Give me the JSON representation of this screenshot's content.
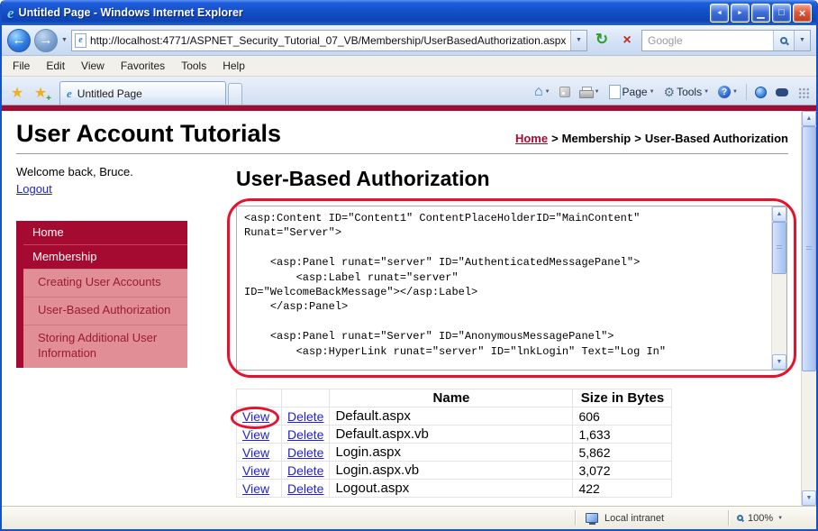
{
  "colors": {
    "accent_red": "#A50B31",
    "nav_secondary_bg": "#E18E96",
    "nav_secondary_text": "#9B1B33",
    "annotation_red": "#E8112D",
    "link_blue": "#2222CC"
  },
  "icons": {
    "ie_e": "e",
    "back_arrow": "←",
    "forward_arrow": "→",
    "dropdown": "▼",
    "refresh": "↻",
    "stop": "×",
    "minimize": "▁",
    "maximize": "□",
    "close": "×",
    "extra_left": "◄",
    "extra_right": "►",
    "favorites_star": "★",
    "add_star": "★",
    "home": "⌂",
    "gear": "⚙",
    "help": "?"
  },
  "window": {
    "title": "Untitled Page - Windows Internet Explorer"
  },
  "address_bar": {
    "url": "http://localhost:4771/ASPNET_Security_Tutorial_07_VB/Membership/UserBasedAuthorization.aspx",
    "search_placeholder": "Google"
  },
  "menu_bar": {
    "items": [
      "File",
      "Edit",
      "View",
      "Favorites",
      "Tools",
      "Help"
    ]
  },
  "tab_bar": {
    "active_tab": "Untitled Page",
    "page_button": "Page",
    "tools_button": "Tools"
  },
  "page": {
    "site_title": "User Account Tutorials",
    "breadcrumb": {
      "home": "Home",
      "sep": ">",
      "level2": "Membership",
      "current": "User-Based Authorization"
    },
    "sidebar": {
      "welcome": "Welcome back, Bruce.",
      "logout": "Logout",
      "nav": [
        {
          "label": "Home"
        },
        {
          "label": "Membership"
        },
        {
          "label": "Creating User Accounts"
        },
        {
          "label": "User-Based Authorization"
        },
        {
          "label": "Storing Additional User Information"
        }
      ]
    },
    "main": {
      "heading": "User-Based Authorization",
      "code": "<asp:Content ID=\"Content1\" ContentPlaceHolderID=\"MainContent\"\nRunat=\"Server\">\n\n    <asp:Panel runat=\"server\" ID=\"AuthenticatedMessagePanel\">\n        <asp:Label runat=\"server\"\nID=\"WelcomeBackMessage\"></asp:Label>\n    </asp:Panel>\n\n    <asp:Panel runat=\"Server\" ID=\"AnonymousMessagePanel\">\n        <asp:HyperLink runat=\"server\" ID=\"lnkLogin\" Text=\"Log In\"",
      "table": {
        "name_header": "Name",
        "size_header": "Size in Bytes",
        "rows": [
          {
            "view": "View",
            "delete": "Delete",
            "name": "Default.aspx",
            "size": "606"
          },
          {
            "view": "View",
            "delete": "Delete",
            "name": "Default.aspx.vb",
            "size": "1,633"
          },
          {
            "view": "View",
            "delete": "Delete",
            "name": "Login.aspx",
            "size": "5,862"
          },
          {
            "view": "View",
            "delete": "Delete",
            "name": "Login.aspx.vb",
            "size": "3,072"
          },
          {
            "view": "View",
            "delete": "Delete",
            "name": "Logout.aspx",
            "size": "422"
          }
        ]
      }
    }
  },
  "status_bar": {
    "zone": "Local intranet",
    "zoom": "100%"
  }
}
